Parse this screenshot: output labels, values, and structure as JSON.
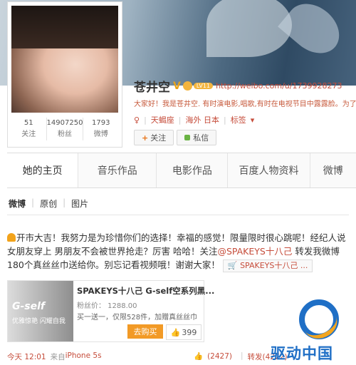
{
  "profile": {
    "name": "苍井空",
    "level": "LV11",
    "url": "http://weibo.com/u/1739928273",
    "bio": "大家好！我是苍井空. 有时演电影,唱歌,有时在电视节目中露露脸。为了",
    "tags": [
      "天蝎座",
      "海外 日本",
      "标签"
    ],
    "follow_label": "关注",
    "message_label": "私信",
    "stats": [
      {
        "value": "51",
        "label": "关注"
      },
      {
        "value": "14907250",
        "label": "粉丝"
      },
      {
        "value": "1793",
        "label": "微博"
      }
    ]
  },
  "tabs": [
    "她的主页",
    "音乐作品",
    "电影作品",
    "百度人物资料",
    "微博"
  ],
  "subnav": [
    "微博",
    "原创",
    "图片"
  ],
  "post": {
    "text1": "开市大吉！我努力是为珍惜你们的选择！幸福的感觉！限量限时很心跳呢！经纪人说 女朋友穿上 男朋友不会被世界抢走？厉害 哈哈！关注",
    "mention": "@SPAKEYS十八己",
    "text2": " 转发我微博 180个真丝丝巾送给你。别忘记看视频哦！谢谢大家！",
    "link_label": "SPAKEYS十八己 ..."
  },
  "product": {
    "title": "SPAKEYS十八己 G-self空系列黑...",
    "price": "粉丝价： 1288.00",
    "desc": "买一送一，仅限528件，加赠真丝丝巾",
    "buy_label": "去购买",
    "like_count": "399",
    "image_title": "G-self",
    "image_sub": "优雅惊艳 闪耀自我"
  },
  "meta": {
    "time": "今天 12:01",
    "source_prefix": "来自",
    "source": "iPhone 5s",
    "likes": "(2427)",
    "repost": "转发(4272)"
  },
  "watermark": "驱动中国",
  "colors": {
    "accent": "#c64d3b",
    "buy": "#f29a26",
    "brand_blue": "#1f6fc6"
  }
}
